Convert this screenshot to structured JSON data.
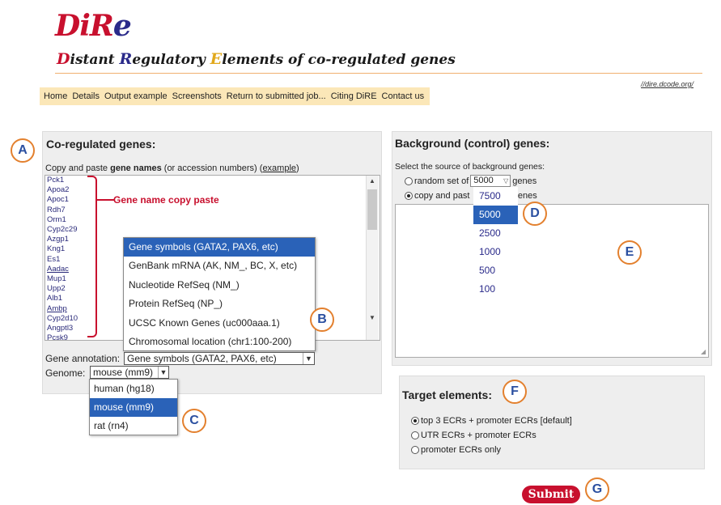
{
  "logo": {
    "d": "D",
    "i": "i",
    "r": "R",
    "e": "e"
  },
  "tagline": {
    "d": "D",
    "rest1": "istant ",
    "r": "R",
    "rest2": "egulatory ",
    "e": "E",
    "rest3": "lements of co-regulated genes"
  },
  "site_link": "//dire.dcode.org/",
  "nav": [
    "Home",
    "Details",
    "Output example",
    "Screenshots",
    "Return to submitted job...",
    "Citing DiRE",
    "Contact us"
  ],
  "left": {
    "title": "Co-regulated genes:",
    "instr_pre": "Copy and paste ",
    "instr_bold": "gene names",
    "instr_mid": " (or accession numbers) (",
    "instr_link": "example",
    "instr_post": ")",
    "genes": [
      "Pck1",
      "Apoa2",
      "Apoc1",
      "Rdh7",
      "Orm1",
      "Cyp2c29",
      "Azgp1",
      "Kng1",
      "Es1",
      "Aadac",
      "Mup1",
      "Upp2",
      "Alb1",
      "Ambp",
      "Cyp2d10",
      "Angptl3",
      "Pcsk9"
    ],
    "gene_note": "Gene name copy paste",
    "annotation_label": "Gene annotation:",
    "annotation_value": "Gene symbols (GATA2, PAX6, etc)",
    "annotation_options": [
      "Gene symbols (GATA2, PAX6, etc)",
      "GenBank mRNA (AK, NM_, BC, X, etc)",
      "Nucleotide RefSeq (NM_)",
      "Protein RefSeq (NP_)",
      "UCSC Known Genes (uc000aaa.1)",
      "Chromosomal location (chr1:100-200)"
    ],
    "genome_label": "Genome:",
    "genome_value": "mouse (mm9)",
    "genome_options": [
      "human (hg18)",
      "mouse (mm9)",
      "rat (rn4)"
    ]
  },
  "right": {
    "title": "Background (control) genes:",
    "instr": "Select the source of background genes:",
    "opt1_pre": "random set of",
    "opt1_value": "5000",
    "opt1_post": "genes",
    "opt2_visible_a": "copy and past",
    "opt2_visible_b": "nd genes",
    "count_options": [
      "7500",
      "5000",
      "2500",
      "1000",
      "500",
      "100"
    ]
  },
  "target": {
    "title": "Target elements:",
    "options": [
      "top 3 ECRs + promoter ECRs [default]",
      "UTR ECRs + promoter ECRs",
      "promoter ECRs only"
    ]
  },
  "submit_label": "Submit",
  "markers": [
    "A",
    "B",
    "C",
    "D",
    "E",
    "F",
    "G"
  ],
  "colors": {
    "accent_red": "#c8102e",
    "logo_blue": "#2a2a8a",
    "nav_bg": "#fbe7b8",
    "select_blue": "#2a62b8",
    "marker_orange": "#e3802e"
  }
}
